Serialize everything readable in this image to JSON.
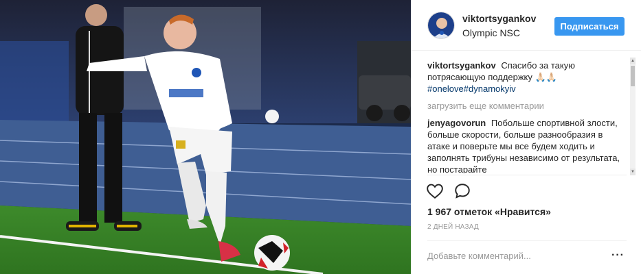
{
  "header": {
    "username": "viktortsygankov",
    "location": "Olympic NSC",
    "follow_label": "Подписаться"
  },
  "comments": {
    "caption": {
      "user": "viktortsygankov",
      "text": "Спасибо за такую потрясающую поддержку 🙏🏻🙏🏻",
      "hashtag": "#onelove#dynamokyiv"
    },
    "load_more": "загрузить еще комментарии",
    "items": [
      {
        "user": "jenyagovorun",
        "text": "Побольше спортивной злости, больше скорости, больше разнообразия в атаке и поверьте мы все будем ходить и заполнять трибуны независимо от результата, но постарайте"
      }
    ]
  },
  "actions": {
    "like_icon": "heart-icon",
    "comment_icon": "speech-bubble-icon"
  },
  "likes": "1 967 отметок «Нравится»",
  "time": "2 ДНЕЙ НАЗАД",
  "add_comment": {
    "placeholder": "Добавьте комментарий...",
    "more_label": "···"
  },
  "colors": {
    "follow_bg": "#3897f0",
    "hashtag": "#003569",
    "muted": "#999999"
  }
}
